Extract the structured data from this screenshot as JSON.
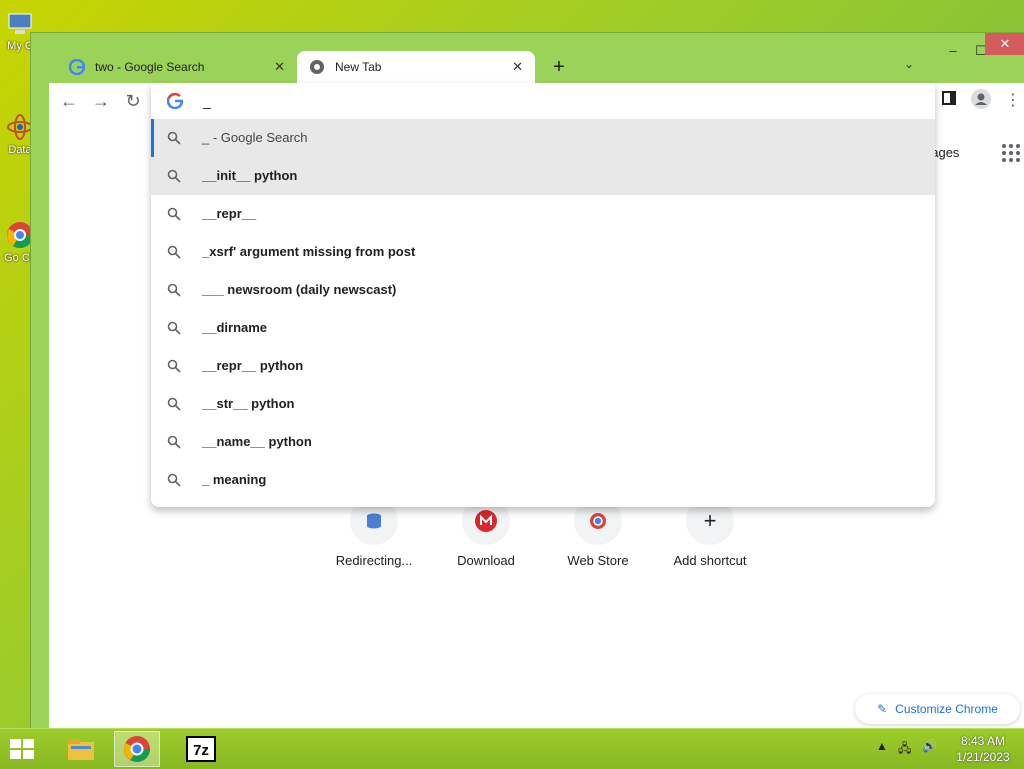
{
  "desktop": {
    "icons": [
      {
        "label": "My C"
      },
      {
        "label": "Data"
      },
      {
        "label": "Go Ch"
      }
    ]
  },
  "browser": {
    "tabs": [
      {
        "title": "two - Google Search",
        "active": false
      },
      {
        "title": "New Tab",
        "active": true
      }
    ],
    "newtab_label": "+",
    "omnibox": {
      "value": "_",
      "suggestions": [
        {
          "text": "_ - Google Search",
          "type": "search-what-you-typed"
        },
        {
          "text": "__init__ python"
        },
        {
          "text": "__repr__"
        },
        {
          "text": "_xsrf' argument missing from post"
        },
        {
          "text": "___ newsroom (daily newscast)"
        },
        {
          "text": "__dirname"
        },
        {
          "text": "__repr__ python"
        },
        {
          "text": "__str__ python"
        },
        {
          "text": "__name__ python"
        },
        {
          "text": "_ meaning"
        }
      ]
    },
    "ntp": {
      "images_link": "nages",
      "shortcuts": [
        {
          "label": "Redirecting..."
        },
        {
          "label": "Download"
        },
        {
          "label": "Web Store"
        },
        {
          "label": "Add shortcut"
        }
      ],
      "customize_label": "Customize Chrome"
    }
  },
  "taskbar": {
    "time": "8:43 AM",
    "date": "1/21/2023"
  },
  "colors": {
    "accent": "#1a73e8",
    "highlight": "#e8e8e8",
    "frame": "#9bd35a"
  }
}
